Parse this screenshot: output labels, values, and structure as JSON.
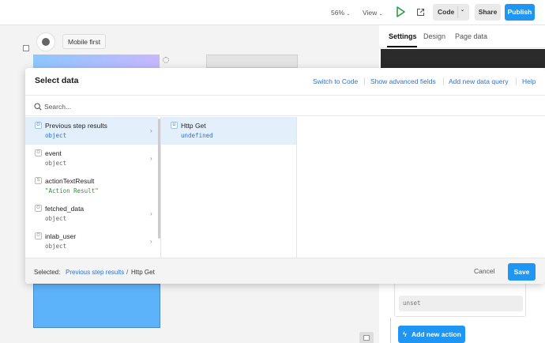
{
  "topbar": {
    "zoom": "56%",
    "view": "View",
    "code": "Code",
    "share": "Share",
    "publish": "Publish"
  },
  "canvas": {
    "mobile_first": "Mobile first"
  },
  "right_panel": {
    "tabs": [
      "Settings",
      "Design",
      "Page data"
    ],
    "unset_value": "unset",
    "add_action": "Add new action"
  },
  "modal": {
    "title": "Select data",
    "links": [
      "Switch to Code",
      "Show advanced fields",
      "Add new data query",
      "Help"
    ],
    "search_placeholder": "Search...",
    "items": [
      {
        "badge": "O",
        "name": "Previous step results",
        "type": "object"
      },
      {
        "badge": "O",
        "name": "event",
        "type": "object"
      },
      {
        "badge": "S",
        "name": "actionTextResult",
        "type": "\"Action Result\""
      },
      {
        "badge": "O",
        "name": "fetched_data",
        "type": "object"
      },
      {
        "badge": "O",
        "name": "inlab_user",
        "type": "object"
      }
    ],
    "sub_items": [
      {
        "badge": "U",
        "name": "Http Get",
        "type": "undefined"
      }
    ],
    "footer": {
      "selected_label": "Selected:",
      "crumb1": "Previous step results",
      "separator": "/",
      "crumb2": "Http Get",
      "cancel": "Cancel",
      "save": "Save"
    }
  },
  "colors": {
    "accent": "#1f96f3",
    "link": "#2a73d9",
    "selected_row": "#e3f0fc",
    "canvas_block": "#5cb3fa",
    "dark_panel": "#2b2b2b"
  }
}
